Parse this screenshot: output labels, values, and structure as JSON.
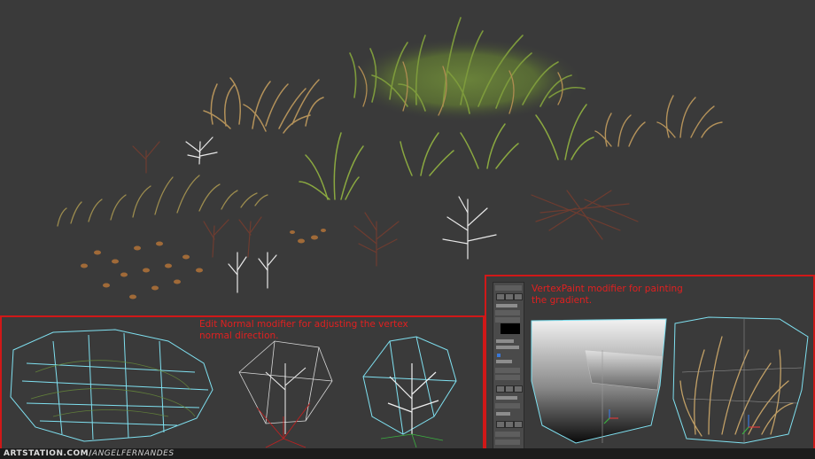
{
  "annotations": {
    "edit_normal": "Edit Normal modifier for adjusting the vertex normal direction.",
    "vertex_paint": "VertexPaint modifier for painting the gradient."
  },
  "footer": {
    "brand": "ARTSTATION.COM/",
    "author": "ANGELFERNANDES"
  },
  "colors": {
    "background": "#3a3a3a",
    "highlight_border": "#d01818",
    "annotation_text": "#e02020",
    "wireframe": "#7fe0f0",
    "dry_grass": "#b4925a",
    "green_grass": "#8aa840",
    "dead_branch": "#6e3c30",
    "white_branch": "#e8e8e8"
  },
  "icons": {
    "gizmo": "xyz-axis-gizmo",
    "rollout": "command-panel"
  }
}
